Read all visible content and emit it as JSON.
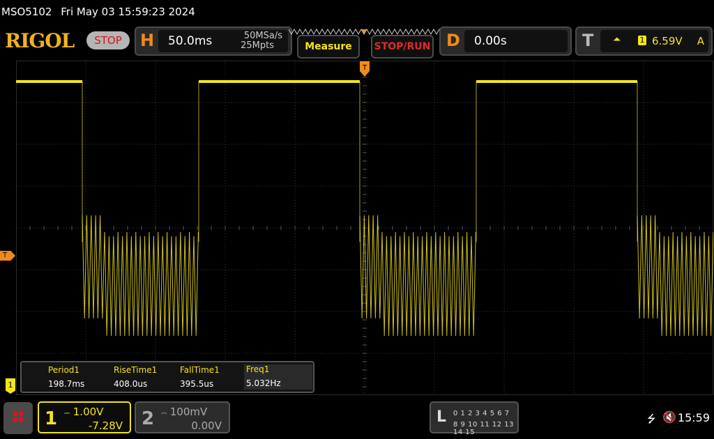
{
  "status": {
    "model": "MSO5102",
    "datetime": "Fri May 03 15:59:23 2024"
  },
  "top": {
    "logo": "RIGOL",
    "run_state": "STOP",
    "horizontal": {
      "letter": "H",
      "timebase": "50.0ms",
      "sample_rate": "50MSa/s",
      "memory_depth": "25Mpts"
    },
    "measure_label": "Measure",
    "stoprun_label": "STOP/RUN",
    "delay": {
      "letter": "D",
      "value": "0.00s"
    },
    "trigger": {
      "letter": "T",
      "source": "1",
      "level": "6.59V",
      "mode": "A",
      "slope_icon": "rising-edge-icon"
    }
  },
  "markers": {
    "trigger_top": "T",
    "trigger_left": "T",
    "ch1": "1"
  },
  "measurements": [
    {
      "label": "Period1",
      "value": "198.7ms"
    },
    {
      "label": "RiseTime1",
      "value": "408.0us"
    },
    {
      "label": "FallTime1",
      "value": "395.5us"
    },
    {
      "label": "Freq1",
      "value": "5.032Hz"
    }
  ],
  "channels": [
    {
      "num": "1",
      "scale": "1.00V",
      "offset": "-7.28V",
      "color": "#f5e41a",
      "active": true
    },
    {
      "num": "2",
      "scale": "100mV",
      "offset": "0.00V",
      "color": "#888888",
      "active": false
    }
  ],
  "logic": {
    "letter": "L",
    "row1": "0 1 2 3  4 5 6 7",
    "row2": "8 9 10 11 12 13 14 15"
  },
  "system": {
    "clock": "15:59",
    "usb_icon": "usb-icon",
    "sound_icon": "speaker-muted-icon"
  },
  "colors": {
    "trace": "#f5e41a",
    "accent": "#f08a1c",
    "grid": "#3a3a3a"
  }
}
